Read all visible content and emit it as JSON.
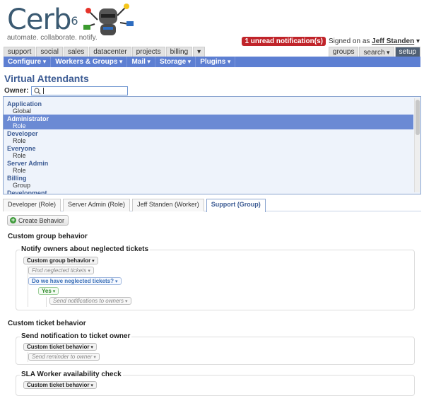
{
  "app": {
    "logo_text": "Cerb",
    "logo_version": "6",
    "tagline": "automate. collaborate. notify."
  },
  "header": {
    "notifications": "1 unread notification(s)",
    "signed_on_prefix": "Signed on as",
    "user_name": "Jeff Standen"
  },
  "workspace_tabs": [
    "support",
    "social",
    "sales",
    "datacenter",
    "projects",
    "billing"
  ],
  "right_tabs": {
    "groups": "groups",
    "search": "search",
    "setup": "setup"
  },
  "menu": [
    "Configure",
    "Workers & Groups",
    "Mail",
    "Storage",
    "Plugins"
  ],
  "page": {
    "title": "Virtual Attendants",
    "owner_label": "Owner:",
    "owner_value": ""
  },
  "chooser_items": [
    {
      "name": "Application",
      "type": "Global",
      "selected": false
    },
    {
      "name": "Administrator",
      "type": "Role",
      "selected": true
    },
    {
      "name": "Developer",
      "type": "Role",
      "selected": false
    },
    {
      "name": "Everyone",
      "type": "Role",
      "selected": false
    },
    {
      "name": "Server Admin",
      "type": "Role",
      "selected": false
    },
    {
      "name": "Billing",
      "type": "Group",
      "selected": false
    },
    {
      "name": "Development",
      "type": "",
      "selected": false
    }
  ],
  "owner_tabs": [
    {
      "label": "Developer (Role)",
      "active": false
    },
    {
      "label": "Server Admin (Role)",
      "active": false
    },
    {
      "label": "Jeff Standen (Worker)",
      "active": false
    },
    {
      "label": "Support (Group)",
      "active": true
    }
  ],
  "create_behavior_label": "Create Behavior",
  "sections": {
    "group_title": "Custom group behavior",
    "ticket_title": "Custom ticket behavior"
  },
  "behaviors": {
    "neglected": {
      "title": "Notify owners about neglected tickets",
      "trigger": "Custom group behavior",
      "action1": "Find neglected tickets",
      "switch": "Do we have neglected tickets?",
      "outcome": "Yes",
      "action2": "Send notifications to owners"
    },
    "ticket_owner": {
      "title": "Send notification to ticket owner",
      "trigger": "Custom ticket behavior",
      "action1": "Send reminder to owner"
    },
    "sla": {
      "title": "SLA Worker availability check",
      "trigger": "Custom ticket behavior"
    }
  },
  "colors": {
    "menu_bar": "#5d7fd2",
    "title_blue": "#3d5c94",
    "selected_row": "#6b8ad4",
    "notification_red": "#c0242a",
    "setup_tab": "#4f5f73"
  }
}
